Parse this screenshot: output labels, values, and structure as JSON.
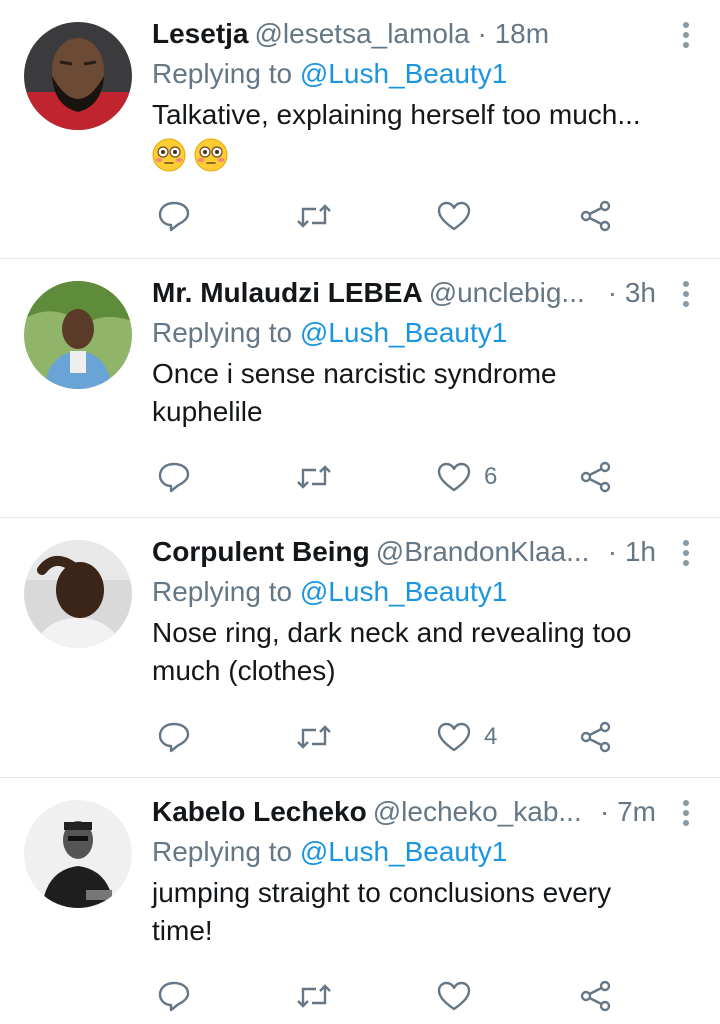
{
  "tweets": [
    {
      "name": "Lesetja",
      "handle": "@lesetsa_lamola",
      "time": "18m",
      "replying_prefix": "Replying to",
      "replying_to": "@Lush_Beauty1",
      "text": "Talkative, explaining herself too much...",
      "emoji": [
        "flushed-face",
        "flushed-face"
      ],
      "like_count": "",
      "avatar": "man-with-beard"
    },
    {
      "name": "Mr. Mulaudzi LEBEA",
      "handle": "@unclebig...",
      "time": "3h",
      "replying_prefix": "Replying to",
      "replying_to": "@Lush_Beauty1",
      "text": "Once i sense narcistic syndrome kuphelile",
      "like_count": "6",
      "avatar": "man-blue-suit-outdoors"
    },
    {
      "name": "Corpulent Being",
      "handle": "@BrandonKlaa...",
      "time": "1h",
      "replying_prefix": "Replying to",
      "replying_to": "@Lush_Beauty1",
      "text": "Nose ring, dark neck and revealing too much (clothes)",
      "like_count": "4",
      "avatar": "man-selfie"
    },
    {
      "name": "Kabelo Lecheko",
      "handle": "@lecheko_kab...",
      "time": "7m",
      "replying_prefix": "Replying to",
      "replying_to": "@Lush_Beauty1",
      "text": "jumping straight to conclusions every time!",
      "like_count": "",
      "avatar": "man-black-and-white"
    }
  ],
  "colors": {
    "link": "#1b95e0",
    "secondary_text": "#657786",
    "divider": "#e1e8ed"
  }
}
